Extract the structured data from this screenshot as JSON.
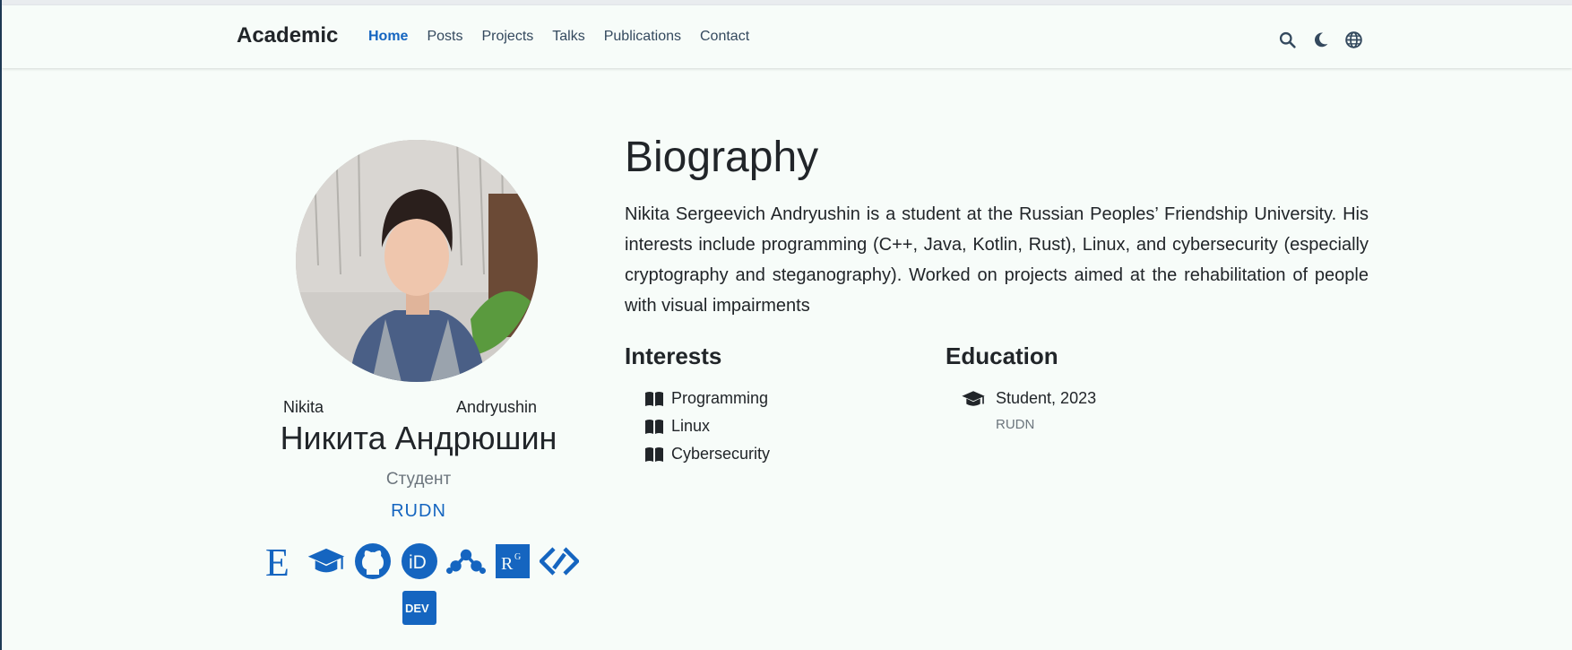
{
  "navbar": {
    "brand": "Academic",
    "links": [
      "Home",
      "Posts",
      "Projects",
      "Talks",
      "Publications",
      "Contact"
    ],
    "active": "Home",
    "icons": [
      "search-icon",
      "moon-icon",
      "globe-icon"
    ]
  },
  "profile": {
    "first_name": "Nikita",
    "last_name": "Andryushin",
    "full_name": "Никита Андрюшин",
    "role": "Студент",
    "organization": "RUDN",
    "social_icons": [
      "e-library-icon",
      "graduation-cap-icon",
      "github-icon",
      "orcid-icon",
      "mendeley-icon",
      "researchgate-icon",
      "gitlab-like-icon",
      "dev-icon"
    ]
  },
  "biography": {
    "title": "Biography",
    "text": "Nikita Sergeevich Andryushin is a student at the Russian Peoples’ Friendship University. His interests include programming (C++, Java, Kotlin, Rust), Linux, and cybersecurity (especially cryptography and steganography). Worked on projects aimed at the rehabilitation of people with visual impairments"
  },
  "interests": {
    "title": "Interests",
    "items": [
      "Programming",
      "Linux",
      "Cybersecurity"
    ]
  },
  "education": {
    "title": "Education",
    "course": "Student, 2023",
    "institution": "RUDN"
  },
  "colors": {
    "accent": "#1565c0",
    "background": "#f7fcf9"
  }
}
